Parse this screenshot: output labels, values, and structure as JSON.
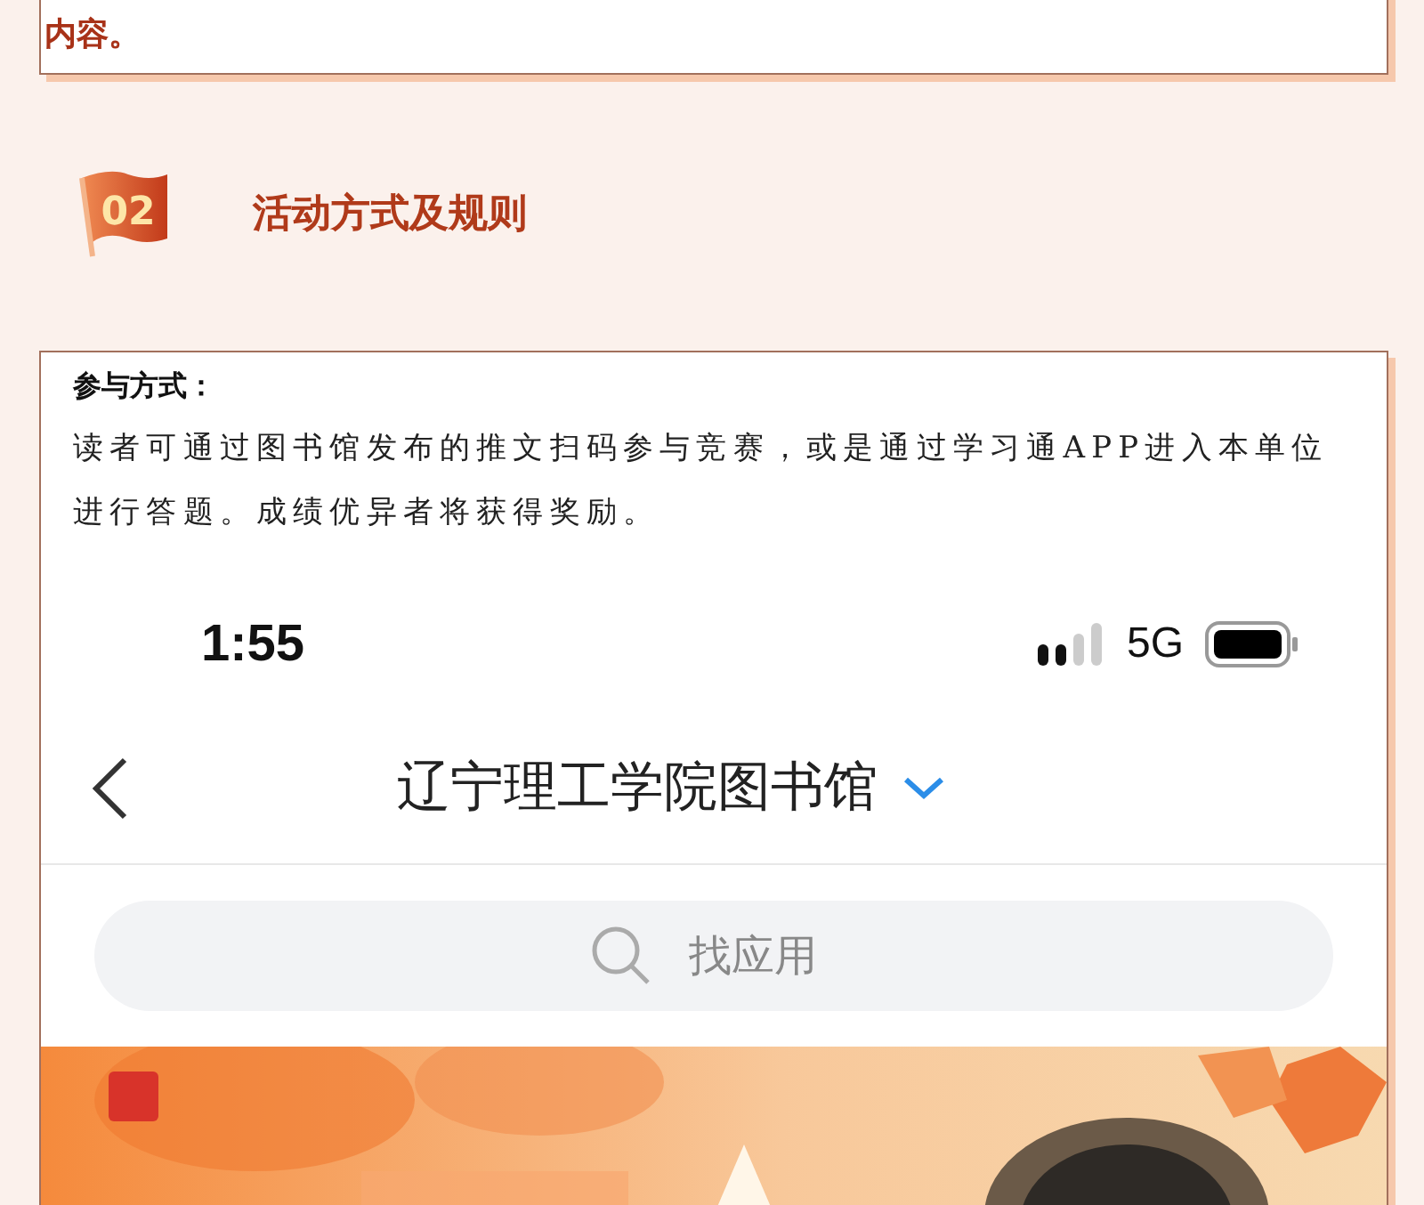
{
  "intro_card": {
    "text": "内容。"
  },
  "section": {
    "number": "02",
    "title": "活动方式及规则"
  },
  "rules_card": {
    "heading": "参与方式：",
    "paragraph": "读者可通过图书馆发布的推文扫码参与竞赛，或是通过学习通APP进入本单位进行答题。成绩优异者将获得奖励。",
    "screenshot": {
      "status_bar": {
        "time": "1:55",
        "network": "5G"
      },
      "nav": {
        "title": "辽宁理工学院图书馆"
      },
      "search": {
        "placeholder": "找应用"
      }
    }
  }
}
